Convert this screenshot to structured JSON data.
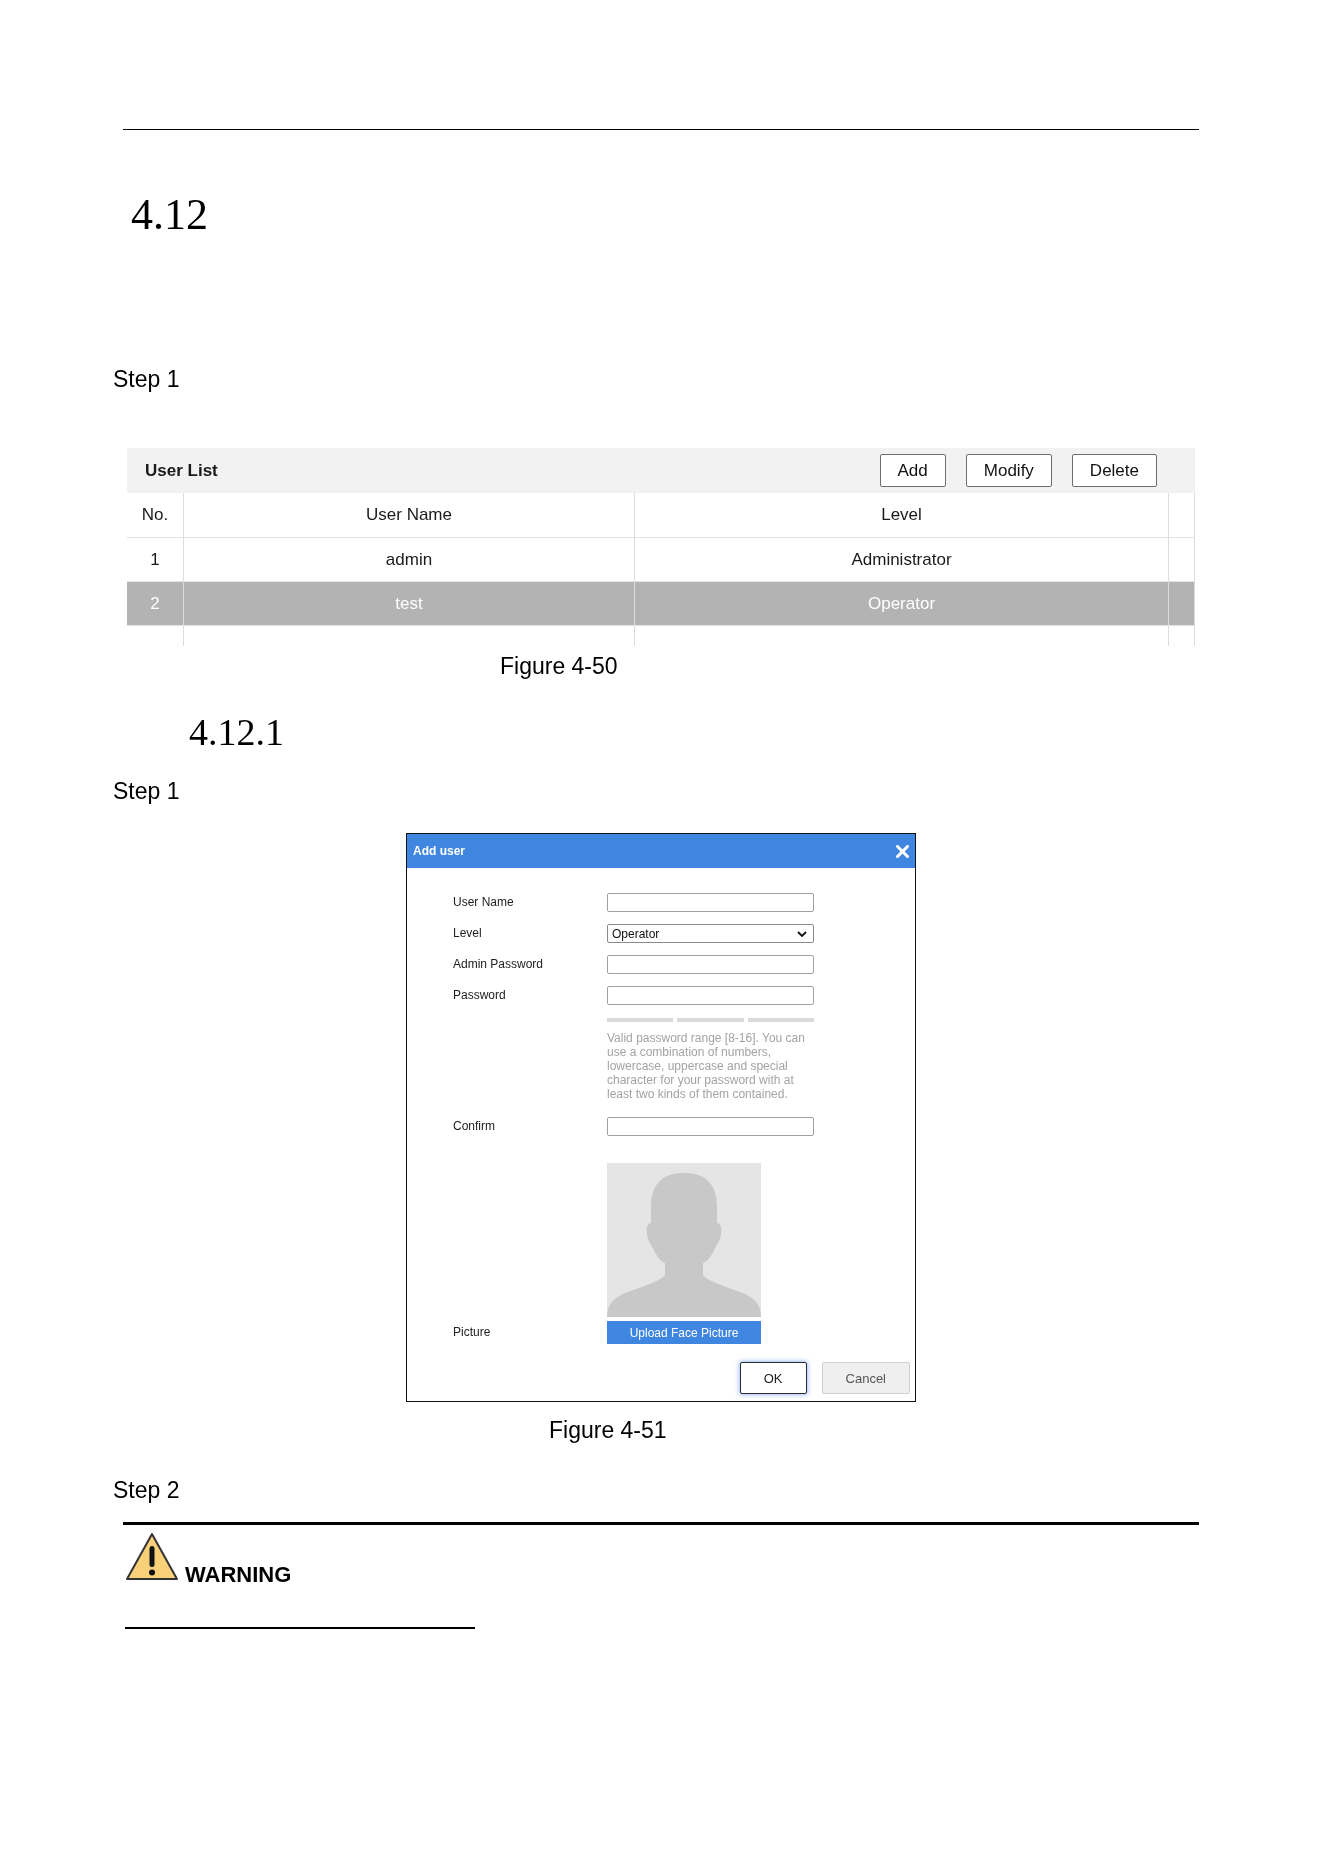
{
  "section": {
    "number": "4.12",
    "step": "Step 1"
  },
  "user_list": {
    "title": "User List",
    "buttons": [
      "Add",
      "Modify",
      "Delete"
    ],
    "columns": [
      "No.",
      "User Name",
      "Level"
    ],
    "rows": [
      {
        "no": "1",
        "user_name": "admin",
        "level": "Administrator",
        "selected": false
      },
      {
        "no": "2",
        "user_name": "test",
        "level": "Operator",
        "selected": true
      }
    ]
  },
  "caption_1": "Figure 4-50",
  "subsection": {
    "number": "4.12.1",
    "step": "Step 1"
  },
  "add_user_dialog": {
    "title": "Add user",
    "fields": [
      {
        "kind": "text",
        "label": "User Name"
      },
      {
        "kind": "select",
        "label": "Level",
        "value": "Operator"
      },
      {
        "kind": "password",
        "label": "Admin Password"
      },
      {
        "kind": "password",
        "label": "Password",
        "strength_meter": true,
        "hint": "Valid password range [8-16]. You can use a combination of numbers, lowercase, uppercase and special character for your password with at least two kinds of them contained."
      },
      {
        "kind": "password",
        "label": "Confirm"
      },
      {
        "kind": "picture",
        "label": "Picture",
        "button": "Upload Face Picture"
      }
    ],
    "buttons": [
      {
        "label": "OK",
        "focused": true
      },
      {
        "label": "Cancel",
        "focused": false
      }
    ]
  },
  "caption_2": "Figure 4-51",
  "next_step": "Step 2",
  "warning": {
    "label": "WARNING"
  }
}
